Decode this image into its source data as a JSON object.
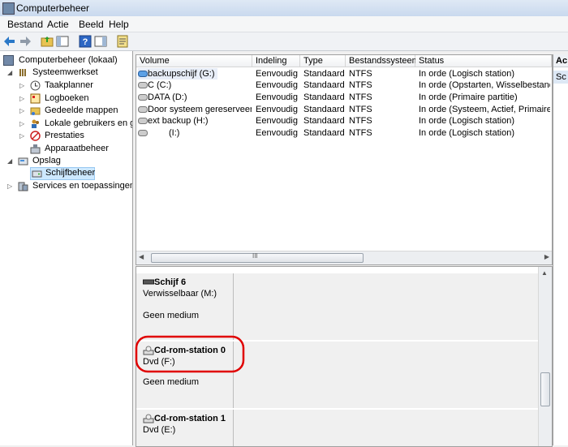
{
  "window": {
    "title": "Computerbeheer"
  },
  "menu": [
    "Bestand",
    "Actie",
    "Beeld",
    "Help"
  ],
  "tree": {
    "root": "Computerbeheer (lokaal)",
    "system_tools": "Systeemwerkset",
    "task_scheduler": "Taakplanner",
    "event_viewer": "Logboeken",
    "shared_folders": "Gedeelde mappen",
    "local_users": "Lokale gebruikers en gr",
    "performance": "Prestaties",
    "device_manager": "Apparaatbeheer",
    "storage": "Opslag",
    "disk_management": "Schijfbeheer",
    "services": "Services en toepassingen"
  },
  "volumes": {
    "headers": [
      "Volume",
      "Indeling",
      "Type",
      "Bestandssysteem",
      "Status"
    ],
    "rows": [
      [
        "backupschijf (G:)",
        "Eenvoudig",
        "Standaard",
        "NTFS",
        "In orde (Logisch station)"
      ],
      [
        "C (C:)",
        "Eenvoudig",
        "Standaard",
        "NTFS",
        "In orde (Opstarten, Wisselbestand, C"
      ],
      [
        "DATA (D:)",
        "Eenvoudig",
        "Standaard",
        "NTFS",
        "In orde (Primaire partitie)"
      ],
      [
        "Door systeem gereserveerd",
        "Eenvoudig",
        "Standaard",
        "NTFS",
        "In orde (Systeem, Actief, Primaire pa"
      ],
      [
        "ext backup (H:)",
        "Eenvoudig",
        "Standaard",
        "NTFS",
        "In orde (Logisch station)"
      ],
      [
        "(I:)",
        "Eenvoudig",
        "Standaard",
        "NTFS",
        "In orde (Logisch station)"
      ]
    ],
    "scroll_glyph": "III"
  },
  "disks": [
    {
      "name": "Schijf 6",
      "type": "Verwisselbaar (M:)",
      "status": "Geen medium"
    },
    {
      "name": "Cd-rom-station 0",
      "type": "Dvd (F:)",
      "status": "Geen medium"
    },
    {
      "name": "Cd-rom-station 1",
      "type": "Dvd (E:)",
      "status": ""
    }
  ],
  "actions": {
    "title": "Ac",
    "item": "Sc"
  },
  "colors": {
    "highlight": "#e00000",
    "selection": "#cde8ff"
  }
}
